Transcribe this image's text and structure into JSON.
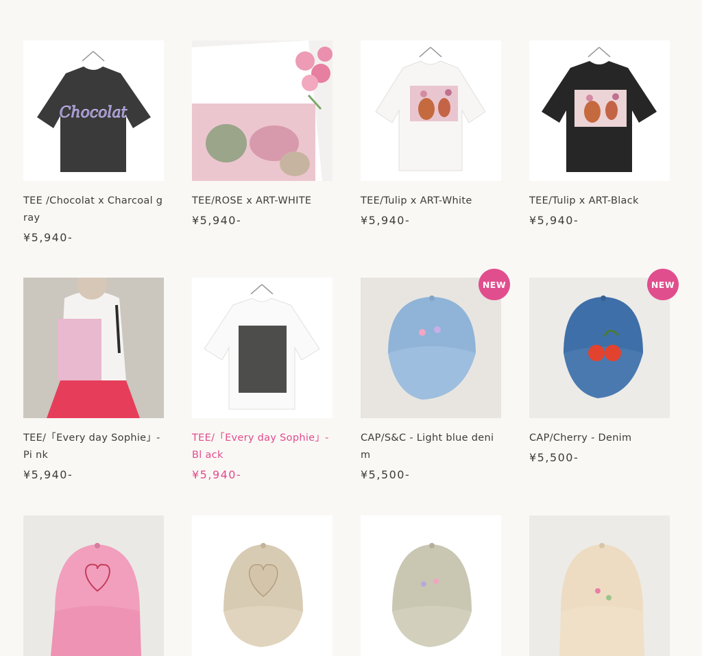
{
  "colors": {
    "background": "#faf8f5",
    "text": "#3e3a39",
    "accent": "#e04b8c",
    "badge": "#e14e8e"
  },
  "products": [
    {
      "name": "TEE /Chocolat x Charcoal g ray",
      "price": "¥5,940-",
      "image": "charcoal-tee-photo"
    },
    {
      "name": "TEE/ROSE x ART-WHITE",
      "price": "¥5,940-",
      "image": "white-rose-tee-photo"
    },
    {
      "name": "TEE/Tulip x ART-White",
      "price": "¥5,940-",
      "image": "white-tulip-tee-photo"
    },
    {
      "name": "TEE/Tulip x ART-Black",
      "price": "¥5,940-",
      "image": "black-tulip-tee-photo"
    },
    {
      "name": "TEE/「Every day Sophie」-Pi nk",
      "price": "¥5,940-",
      "image": "model-pink-tee-photo"
    },
    {
      "name": "TEE/「Every day Sophie」-Bl ack",
      "price": "¥5,940-",
      "image": "white-black-print-tee-photo"
    },
    {
      "name": "CAP/S&C - Light blue deni m",
      "price": "¥5,500-",
      "image": "light-blue-cap-photo",
      "badge": "NEW"
    },
    {
      "name": "CAP/Cherry - Denim",
      "price": "¥5,500-",
      "image": "denim-cherry-cap-photo",
      "badge": "NEW"
    },
    {
      "name": "",
      "price": "",
      "image": "pink-cap-photo"
    },
    {
      "name": "",
      "price": "",
      "image": "beige-cap-chocolat-photo"
    },
    {
      "name": "",
      "price": "",
      "image": "sage-cap-photo"
    },
    {
      "name": "",
      "price": "",
      "image": "cream-cap-photo"
    }
  ]
}
